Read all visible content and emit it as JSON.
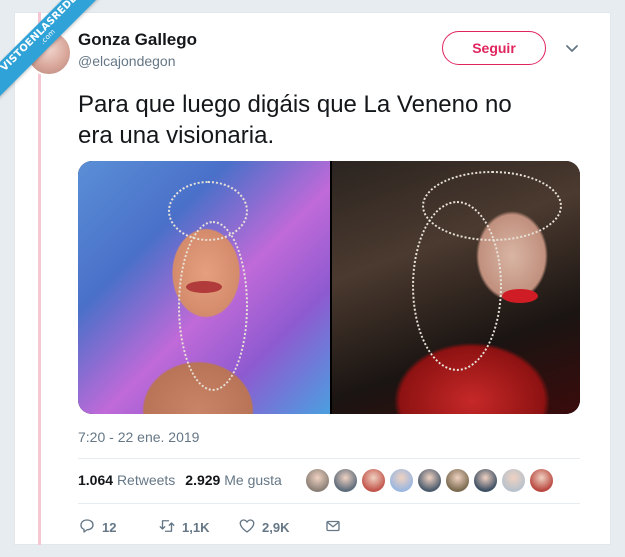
{
  "watermark": {
    "text": "VISTOENLASREDES",
    "sub": ".com"
  },
  "author": {
    "name": "Gonza Gallego",
    "handle": "@elcajondegon"
  },
  "follow_button": {
    "label": "Seguir"
  },
  "tweet": {
    "text_line1": "Para que luego digáis que La Veneno no",
    "text_line2": "era una visionaria.",
    "timestamp": "7:20 - 22 ene. 2019"
  },
  "stats": {
    "retweets_count": "1.064",
    "retweets_label": "Retweets",
    "likes_count": "2.929",
    "likes_label": "Me gusta"
  },
  "likers_colors": [
    "#8a7f76",
    "#5c6b7a",
    "#c2554b",
    "#9bb7e0",
    "#4a5a6b",
    "#7a6a4f",
    "#3d4f63",
    "#b8c2cc",
    "#b9473f"
  ],
  "actions": {
    "reply_count": "12",
    "retweet_count": "1,1K",
    "like_count": "2,9K"
  },
  "colors": {
    "accent": "#e0245e",
    "muted": "#657786",
    "text": "#14171a",
    "ribbon": "#2fa3d8"
  }
}
